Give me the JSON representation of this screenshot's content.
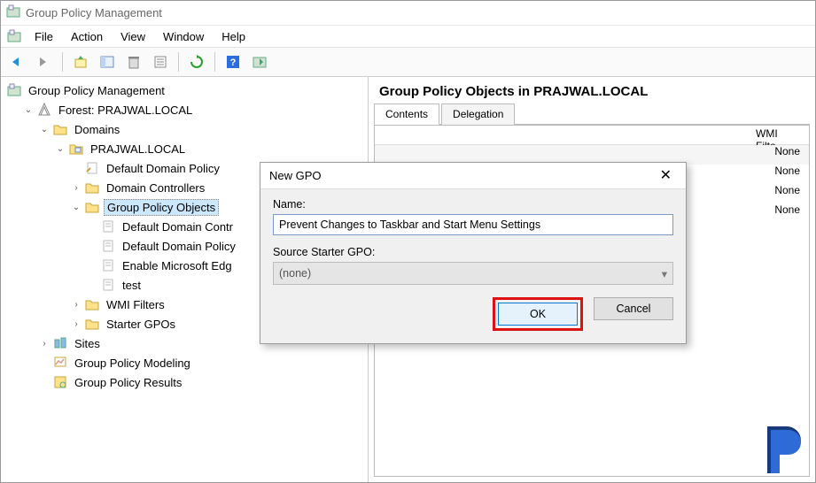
{
  "window": {
    "title": "Group Policy Management"
  },
  "menubar": {
    "file": "File",
    "action": "Action",
    "view": "View",
    "window": "Window",
    "help": "Help"
  },
  "tree": {
    "root": "Group Policy Management",
    "forest": "Forest: PRAJWAL.LOCAL",
    "domains": "Domains",
    "domain": "PRAJWAL.LOCAL",
    "ddp": "Default Domain Policy",
    "dc": "Domain Controllers",
    "gpo": "Group Policy Objects",
    "gpo_children": {
      "a": "Default Domain Contr",
      "b": "Default Domain Policy",
      "c": "Enable Microsoft Edg",
      "d": "test"
    },
    "wmi": "WMI Filters",
    "starter": "Starter GPOs",
    "sites": "Sites",
    "gpm": "Group Policy Modeling",
    "gpr": "Group Policy Results"
  },
  "right": {
    "title": "Group Policy Objects in PRAJWAL.LOCAL",
    "tabs": {
      "contents": "Contents",
      "delegation": "Delegation"
    },
    "wmi_header": "WMI Filte",
    "cells": {
      "r0": "None",
      "r1": "None",
      "r2": "None",
      "r3": "None"
    }
  },
  "dialog": {
    "title": "New GPO",
    "name_label": "Name:",
    "name_value": "Prevent Changes to Taskbar and Start Menu Settings",
    "src_label": "Source Starter GPO:",
    "src_value": "(none)",
    "ok": "OK",
    "cancel": "Cancel"
  }
}
